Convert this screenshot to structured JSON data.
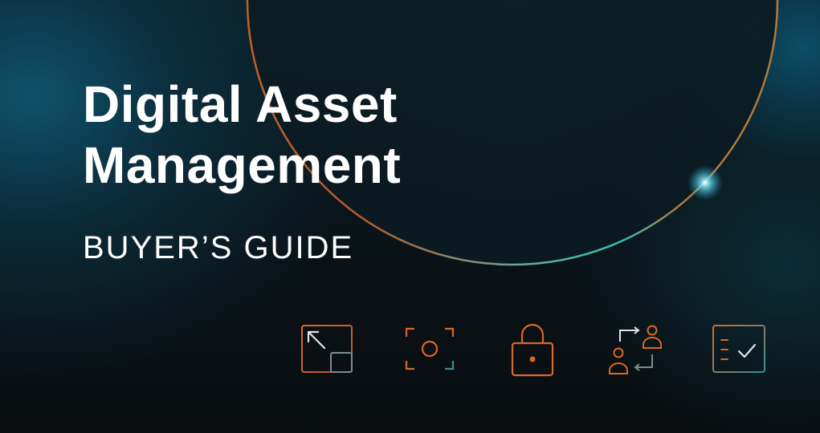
{
  "headline": {
    "line1": "Digital Asset",
    "line2": "Management"
  },
  "subtitle": "BUYER’S GUIDE",
  "icons": [
    "resize-icon",
    "focus-icon",
    "lock-icon",
    "user-exchange-icon",
    "checklist-icon"
  ],
  "colors": {
    "text": "#ffffff",
    "accent_orange": "#d9662a",
    "accent_teal": "#2aa8a8",
    "background": "#0a1116"
  }
}
